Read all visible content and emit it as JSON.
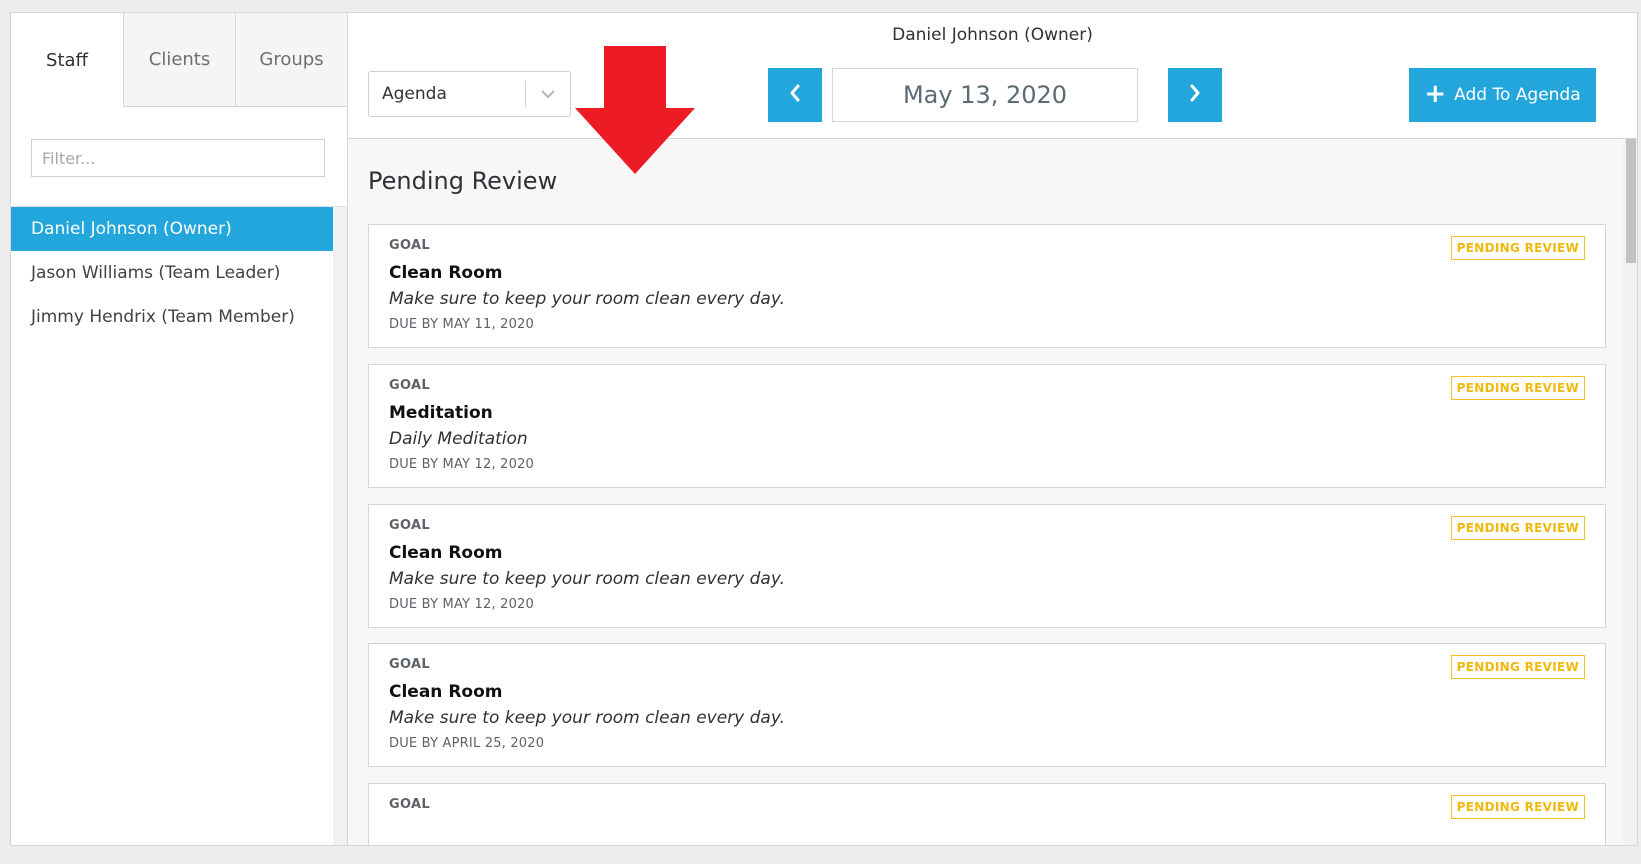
{
  "sidebar": {
    "tabs": [
      {
        "label": "Staff",
        "active": true
      },
      {
        "label": "Clients",
        "active": false
      },
      {
        "label": "Groups",
        "active": false
      }
    ],
    "filter": {
      "placeholder": "Filter...",
      "value": ""
    },
    "staff": [
      {
        "label": "Daniel Johnson (Owner)",
        "selected": true
      },
      {
        "label": "Jason Williams (Team Leader)",
        "selected": false
      },
      {
        "label": "Jimmy Hendrix (Team Member)",
        "selected": false
      }
    ]
  },
  "header": {
    "title": "Daniel Johnson (Owner)",
    "view_select": {
      "value": "Agenda",
      "icon": "chevron-down-icon"
    },
    "date": "May 13, 2020",
    "prev_icon": "chevron-left-icon",
    "next_icon": "chevron-right-icon",
    "add_button": {
      "label": "Add To Agenda",
      "icon": "plus-icon"
    }
  },
  "main": {
    "section_title": "Pending Review",
    "goals": [
      {
        "type": "GOAL",
        "name": "Clean Room",
        "description": "Make sure to keep your room clean every day.",
        "due": "DUE BY MAY 11, 2020",
        "status": "PENDING REVIEW"
      },
      {
        "type": "GOAL",
        "name": "Meditation",
        "description": "Daily Meditation",
        "due": "DUE BY MAY 12, 2020",
        "status": "PENDING REVIEW"
      },
      {
        "type": "GOAL",
        "name": "Clean Room",
        "description": "Make sure to keep your room clean every day.",
        "due": "DUE BY MAY 12, 2020",
        "status": "PENDING REVIEW"
      },
      {
        "type": "GOAL",
        "name": "Clean Room",
        "description": "Make sure to keep your room clean every day.",
        "due": "DUE BY APRIL 25, 2020",
        "status": "PENDING REVIEW"
      },
      {
        "type": "GOAL",
        "name": "",
        "description": "",
        "due": "",
        "status": "PENDING REVIEW"
      }
    ]
  },
  "colors": {
    "accent": "#22a6dc",
    "badge": "#f0b90b",
    "annotation_arrow": "#ed1c24"
  }
}
